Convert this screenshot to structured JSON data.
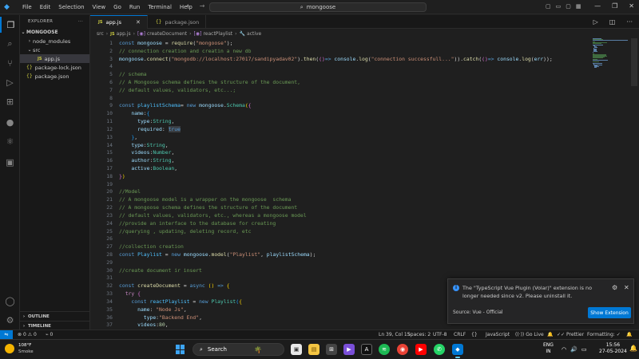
{
  "titlebar": {
    "menu": [
      "File",
      "Edit",
      "Selection",
      "View",
      "Go",
      "Run",
      "Terminal",
      "Help"
    ],
    "search_text": "mongoose",
    "back_arrow": "←",
    "forward_arrow": "→"
  },
  "sidebar": {
    "title": "EXPLORER",
    "more": "···",
    "root": "MONGOOSE",
    "items": [
      {
        "label": "node_modules",
        "type": "folder",
        "depth": 1
      },
      {
        "label": "src",
        "type": "folder-open",
        "depth": 1
      },
      {
        "label": "app.js",
        "type": "js",
        "depth": 2,
        "selected": true
      },
      {
        "label": "package-lock.json",
        "type": "json",
        "depth": 1
      },
      {
        "label": "package.json",
        "type": "json",
        "depth": 1
      }
    ],
    "outline": "OUTLINE",
    "timeline": "TIMELINE"
  },
  "tabs": [
    {
      "label": "app.js",
      "icon": "JS",
      "active": true
    },
    {
      "label": "package.json",
      "icon": "{}",
      "active": false
    }
  ],
  "breadcrumb": {
    "parts": [
      "src",
      "app.js",
      "createDocument",
      "reactPlaylist",
      "active"
    ],
    "js_icon": "JS"
  },
  "editor": {
    "current_line": 39,
    "lines": [
      {
        "n": 1,
        "html": "<span class='t-kw'>const</span> <span class='t-var'>mongoose</span> = <span class='t-fn'>require</span>(<span class='t-str'>\"mongoose\"</span>);"
      },
      {
        "n": 2,
        "html": "<span class='t-cm'>// connection creation and creatin a new db</span>"
      },
      {
        "n": 3,
        "html": "<span class='t-var'>mongoose</span>.<span class='t-fn'>connect</span>(<span class='t-str'>\"mongodb://localhost:27017/sandipyadav02\"</span>).<span class='t-fn'>then</span>(<span class='t-b2'>()</span><span class='t-kw'>=&gt;</span> <span class='t-var'>console</span>.<span class='t-fn'>log</span>(<span class='t-str'>\"connection successfull...\"</span>)).<span class='t-fn'>catch</span>(<span class='t-b2'>()</span><span class='t-kw'>=&gt;</span> <span class='t-var'>console</span>.<span class='t-fn'>log</span>(<span class='t-var'>err</span>));"
      },
      {
        "n": 4,
        "html": ""
      },
      {
        "n": 5,
        "html": "<span class='t-cm'>// schema</span>"
      },
      {
        "n": 6,
        "html": "<span class='t-cm'>// A Mongoose schema defines the structure of the document,</span>"
      },
      {
        "n": 7,
        "html": "<span class='t-cm'>// default values, validators, etc...;</span>"
      },
      {
        "n": 8,
        "html": ""
      },
      {
        "n": 9,
        "html": "<span class='t-kw'>const</span> <span class='t-const'>playlistSchema</span>= <span class='t-kw'>new</span> <span class='t-var'>mongoose</span>.<span class='t-cls'>Schema</span><span class='t-b1'>(</span><span class='t-b2'>{</span>"
      },
      {
        "n": 10,
        "html": "    <span class='t-var'>name</span>:<span class='t-b3'>{</span>"
      },
      {
        "n": 11,
        "html": "      <span class='t-var'>type</span>:<span class='t-cls'>String</span>,"
      },
      {
        "n": 12,
        "html": "      <span class='t-var'>required</span>: <span class='t-kw hl'>true</span>"
      },
      {
        "n": 13,
        "html": "    <span class='t-b3'>}</span>,"
      },
      {
        "n": 14,
        "html": "    <span class='t-var'>type</span>:<span class='t-cls'>String</span>,"
      },
      {
        "n": 15,
        "html": "    <span class='t-var'>videos</span>:<span class='t-cls'>Number</span>,"
      },
      {
        "n": 16,
        "html": "    <span class='t-var'>author</span>:<span class='t-cls'>String</span>,"
      },
      {
        "n": 17,
        "html": "    <span class='t-var'>active</span>:<span class='t-cls'>Boolean</span>,"
      },
      {
        "n": 18,
        "html": "<span class='t-b2'>}</span><span class='t-b1'>)</span>"
      },
      {
        "n": 19,
        "html": ""
      },
      {
        "n": 20,
        "html": "<span class='t-cm'>//Model</span>"
      },
      {
        "n": 21,
        "html": "<span class='t-cm'>// A mongoose model is a wrapper on the mongoose  schema</span>"
      },
      {
        "n": 22,
        "html": "<span class='t-cm'>// A mongoose schema defines the structure of the document</span>"
      },
      {
        "n": 23,
        "html": "<span class='t-cm'>// default values, validators, etc., whereas a mongoose model</span>"
      },
      {
        "n": 24,
        "html": "<span class='t-cm'>//provide an interface to the database for creating</span>"
      },
      {
        "n": 25,
        "html": "<span class='t-cm'>//querying , updating, deleting record, etc</span>"
      },
      {
        "n": 26,
        "html": ""
      },
      {
        "n": 27,
        "html": "<span class='t-cm'>//collection creation</span>"
      },
      {
        "n": 28,
        "html": "<span class='t-kw'>const</span> <span class='t-const'>Playlist</span> = <span class='t-kw'>new</span> <span class='t-var'>mongoose</span>.<span class='t-fn'>model</span>(<span class='t-str'>\"Playlist\"</span>, <span class='t-var'>playlistSchema</span>);"
      },
      {
        "n": 29,
        "html": ""
      },
      {
        "n": 30,
        "html": "<span class='t-cm'>//create document ir insert</span>"
      },
      {
        "n": 31,
        "html": ""
      },
      {
        "n": 32,
        "html": "<span class='t-kw'>const</span> <span class='t-fn'>createDocument</span> = <span class='t-kw'>async</span> <span class='t-b1'>()</span> <span class='t-kw'>=&gt;</span> <span class='t-b1'>{</span>"
      },
      {
        "n": 33,
        "html": "  <span class='t-ctl'>try</span> <span class='t-b2'>{</span>"
      },
      {
        "n": 34,
        "html": "    <span class='t-kw'>const</span> <span class='t-const'>reactPlaylist</span> = <span class='t-kw'>new</span> <span class='t-cls'>Playlist</span><span class='t-b3'>(</span><span class='t-b1'>{</span>"
      },
      {
        "n": 35,
        "html": "      <span class='t-var'>name</span>: <span class='t-str'>\"Node Js\"</span>,"
      },
      {
        "n": 36,
        "html": "        <span class='t-var'>type</span>:<span class='t-str'>\"Backend End\"</span>,"
      },
      {
        "n": 37,
        "html": "      <span class='t-var'>videos</span>:<span class='t-num'>80</span>,"
      }
    ]
  },
  "notification": {
    "message": "The \"TypeScript Vue Plugin (Volar)\" extension is no longer needed since v2. Please uninstall it.",
    "source": "Source: Vue - Official",
    "button": "Show Extension"
  },
  "statusbar": {
    "errors": "0",
    "warnings": "0",
    "info": "0",
    "position": "Ln 39, Col 15",
    "spaces": "Spaces: 2",
    "encoding": "UTF-8",
    "eol": "CRLF",
    "braces": "{}",
    "language": "JavaScript",
    "golive": "Go Live",
    "prettier": "Prettier",
    "formatting": "Formatting: ✓"
  },
  "taskbar": {
    "temperature": "108°F",
    "weather": "Smoke",
    "search": "Search",
    "lang_top": "ENG",
    "lang_bottom": "IN",
    "time": "15:56",
    "date": "27-05-2024"
  },
  "colors": {
    "accent": "#0078d4",
    "editor_bg": "#1f1f1f",
    "sidebar_bg": "#181818"
  }
}
